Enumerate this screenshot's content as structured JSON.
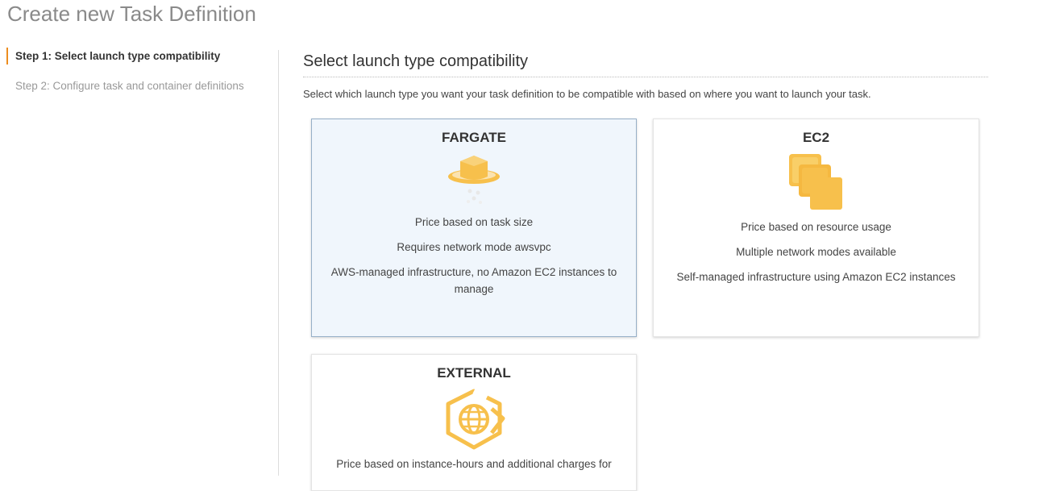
{
  "page": {
    "title": "Create new Task Definition"
  },
  "steps": [
    {
      "label": "Step 1: Select launch type compatibility",
      "active": true
    },
    {
      "label": "Step 2: Configure task and container definitions",
      "active": false
    }
  ],
  "section": {
    "title": "Select launch type compatibility",
    "description": "Select which launch type you want your task definition to be compatible with based on where you want to launch your task."
  },
  "cards": {
    "fargate": {
      "title": "FARGATE",
      "icon": "fargate-icon",
      "lines": [
        "Price based on task size",
        "Requires network mode awsvpc",
        "AWS-managed infrastructure, no Amazon EC2 instances to manage"
      ],
      "selected": true
    },
    "ec2": {
      "title": "EC2",
      "icon": "ec2-icon",
      "lines": [
        "Price based on resource usage",
        "Multiple network modes available",
        "Self-managed infrastructure using Amazon EC2 instances"
      ],
      "selected": false
    },
    "external": {
      "title": "EXTERNAL",
      "icon": "external-icon",
      "lines": [
        "Price based on instance-hours and additional charges for"
      ],
      "selected": false
    }
  },
  "colors": {
    "accent": "#ec8d1f",
    "icon_orange": "#f7c04c",
    "selected_bg": "#f0f6fc",
    "selected_border": "#97b0c8"
  }
}
